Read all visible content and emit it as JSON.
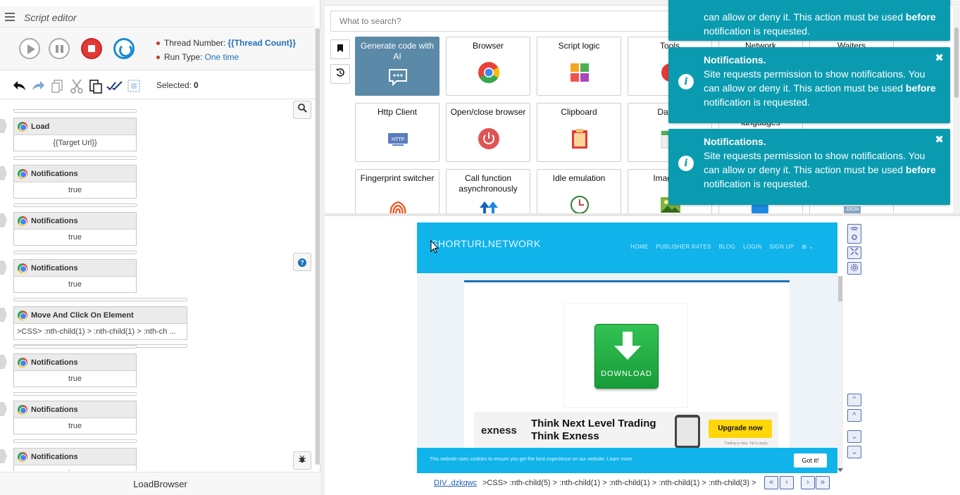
{
  "editor": {
    "title": "Script editor",
    "thread_number_label": "Thread Number:",
    "thread_number_value": "{{Thread Count}}",
    "run_type_label": "Run Type:",
    "run_type_value": "One time",
    "selected_label": "Selected:",
    "selected_value": "0",
    "footer": "LoadBrowser"
  },
  "actions": [
    {
      "title": "Load",
      "value": "{{Target Url}}"
    },
    {
      "title": "Notifications",
      "value": "true"
    },
    {
      "title": "Notifications",
      "value": "true"
    },
    {
      "title": "Notifications",
      "value": "true"
    },
    {
      "title": "Move And Click On Element",
      "value": ">CSS> :nth-child(1) > :nth-child(1) > :nth-ch ..."
    },
    {
      "title": "Notifications",
      "value": "true"
    },
    {
      "title": "Notifications",
      "value": "true"
    },
    {
      "title": "Notifications",
      "value": "true"
    }
  ],
  "palette": {
    "search_placeholder": "What to search?",
    "tiles": [
      {
        "label": "Generate code with AI",
        "icon": "chat-bubble-icon"
      },
      {
        "label": "Browser",
        "icon": "chrome-icon"
      },
      {
        "label": "Script logic",
        "icon": "puzzle-icon"
      },
      {
        "label": "Tools",
        "icon": "tools-icon"
      },
      {
        "label": "Http Client",
        "icon": "http-icon"
      },
      {
        "label": "Open/close browser",
        "icon": "power-icon"
      },
      {
        "label": "Clipboard",
        "icon": "clipboard-icon"
      },
      {
        "label": "Date a",
        "icon": "calendar-icon"
      },
      {
        "label": "Fingerprint switcher",
        "icon": "fingerprint-icon"
      },
      {
        "label": "Call function asynchronously",
        "icon": "async-arrows-icon"
      },
      {
        "label": "Idle emulation",
        "icon": "idle-clock-icon"
      },
      {
        "label": "Image pr",
        "icon": "image-icon"
      }
    ],
    "hidden_labels": [
      "Network",
      "Waiters",
      "languages"
    ],
    "json_badge": "JSON"
  },
  "notifications": [
    {
      "title": "",
      "message_pre": "can allow or deny it. This action must be used ",
      "bold": "before",
      "message_post": " notification is requested."
    },
    {
      "title": "Notifications.",
      "message_pre": "Site requests permission to show notifications. You can allow or deny it. This action must be used ",
      "bold": "before",
      "message_post": " notification is requested."
    },
    {
      "title": "Notifications.",
      "message_pre": "Site requests permission to show notifications. You can allow or deny it. This action must be used ",
      "bold": "before",
      "message_post": " notification is requested."
    }
  ],
  "site": {
    "logo": "SHORTURLNETWORK",
    "nav": [
      "HOME",
      "PUBLISHER RATES",
      "BLOG",
      "LOGIN",
      "SIGN UP"
    ],
    "download_label": "DOWNLOAD",
    "ad_brand": "exness",
    "ad_line1": "Think Next Level Trading",
    "ad_line2": "Think Exness",
    "ad_cta": "Upgrade now",
    "ad_small": "Trading is risky. T&Cs apply.",
    "cookie_text": "This website uses cookies to ensure you get the best experience on our website. Learn more",
    "cookie_button": "Got it!"
  },
  "path": {
    "link": "DIV .dzkqwc",
    "text": ">CSS> :nth-child(5) > :nth-child(1) > :nth-child(1) > :nth-child(1) > :nth-child(3) >"
  },
  "colors": {
    "toast": "#0a9bb0",
    "featured_tile": "#5b8aa8",
    "site_header": "#10b3ea",
    "stop": "#e53935",
    "link": "#1e6fb8"
  }
}
